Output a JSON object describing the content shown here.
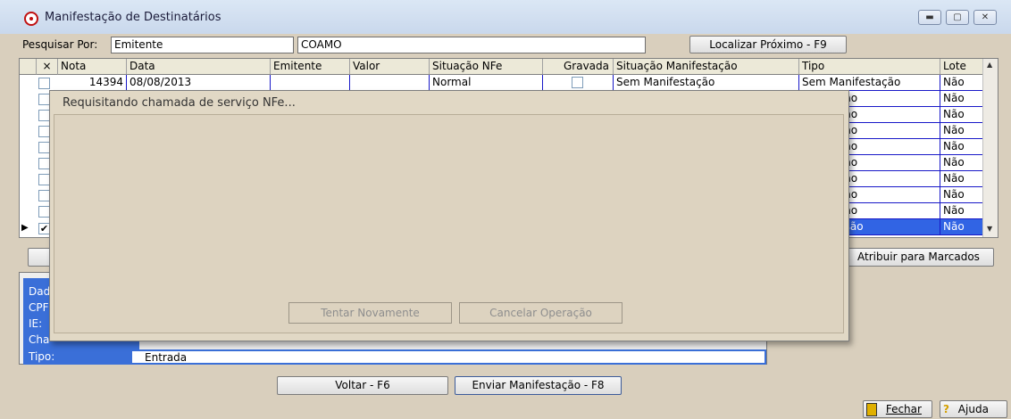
{
  "window": {
    "title": "Manifestação de Destinatários"
  },
  "search": {
    "label": "Pesquisar Por:",
    "field_value": "Emitente",
    "term_value": "COAMO",
    "find_next_label": "Localizar Próximo - F9"
  },
  "grid": {
    "headers": [
      "×",
      "Nota",
      "Data",
      "Emitente",
      "Valor",
      "Situação NFe",
      "Gravada",
      "Situação Manifestação",
      "Tipo",
      "Lote"
    ],
    "first_row": {
      "nota": "14394",
      "data": "08/08/2013",
      "situacao_nfe": "Normal",
      "situacao_manifestacao": "Sem Manifestação",
      "tipo": "Sem Manifestação",
      "lote": "Não"
    },
    "partial_tipo": [
      "nifestação",
      "nifestação",
      "nifestação",
      "nifestação",
      "nifestação",
      "nifestação",
      "nifestação",
      "nifestação"
    ],
    "partial_lote": [
      "Não",
      "Não",
      "Não",
      "Não",
      "Não",
      "Não",
      "Não",
      "Não"
    ],
    "selected_row": {
      "tipo": "da Emissão",
      "lote": "Não"
    }
  },
  "assign_button": {
    "label": "Atribuir para Marcados"
  },
  "details": {
    "partial_labels": [
      "Dad",
      "CPF",
      "IE:",
      "Cha"
    ],
    "tipo_label": "Tipo:",
    "tipo_value": "Entrada"
  },
  "dialog": {
    "title": "Requisitando chamada de serviço NFe...",
    "retry_label": "Tentar Novamente",
    "cancel_label": "Cancelar Operação"
  },
  "buttons": {
    "back": "Voltar - F6",
    "send": "Enviar Manifestação - F8"
  },
  "statusbar": {
    "close": "Fechar",
    "help": "Ajuda"
  },
  "colors": {
    "selection": "#3164e4",
    "panel": "#3a6fd8",
    "background": "#d9cfbd"
  }
}
